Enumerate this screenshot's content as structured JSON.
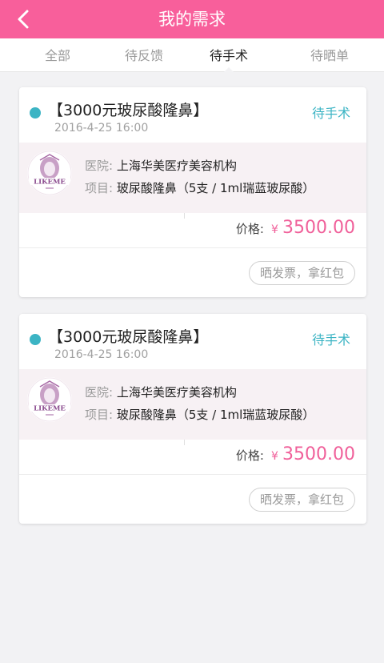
{
  "header": {
    "title": "我的需求",
    "back_icon": "chevron-left-icon"
  },
  "tabs": [
    {
      "label": "全部",
      "active": false
    },
    {
      "label": "待反馈",
      "active": false
    },
    {
      "label": "待手术",
      "active": true
    },
    {
      "label": "待晒单",
      "active": false
    }
  ],
  "orders": [
    {
      "title": "【3000元玻尿酸隆鼻】",
      "date": "2016-4-25 16:00",
      "status": "待手术",
      "hospital_label": "医院:",
      "hospital": "上海华美医疗美容机构",
      "project_label": "项目:",
      "project": "玻尿酸隆鼻（5支 / 1ml瑞蓝玻尿酸）",
      "price_label": "价格:",
      "currency": "¥",
      "price": "3500.00",
      "action_label": "晒发票，拿红包"
    },
    {
      "title": "【3000元玻尿酸隆鼻】",
      "date": "2016-4-25 16:00",
      "status": "待手术",
      "hospital_label": "医院:",
      "hospital": "上海华美医疗美容机构",
      "project_label": "项目:",
      "project": "玻尿酸隆鼻（5支 / 1ml瑞蓝玻尿酸）",
      "price_label": "价格:",
      "currency": "¥",
      "price": "3500.00",
      "action_label": "晒发票，拿红包"
    }
  ],
  "logo_text": "LIKEME",
  "colors": {
    "accent": "#f85f9b",
    "status": "#3cb4c4",
    "price": "#f0609a"
  }
}
